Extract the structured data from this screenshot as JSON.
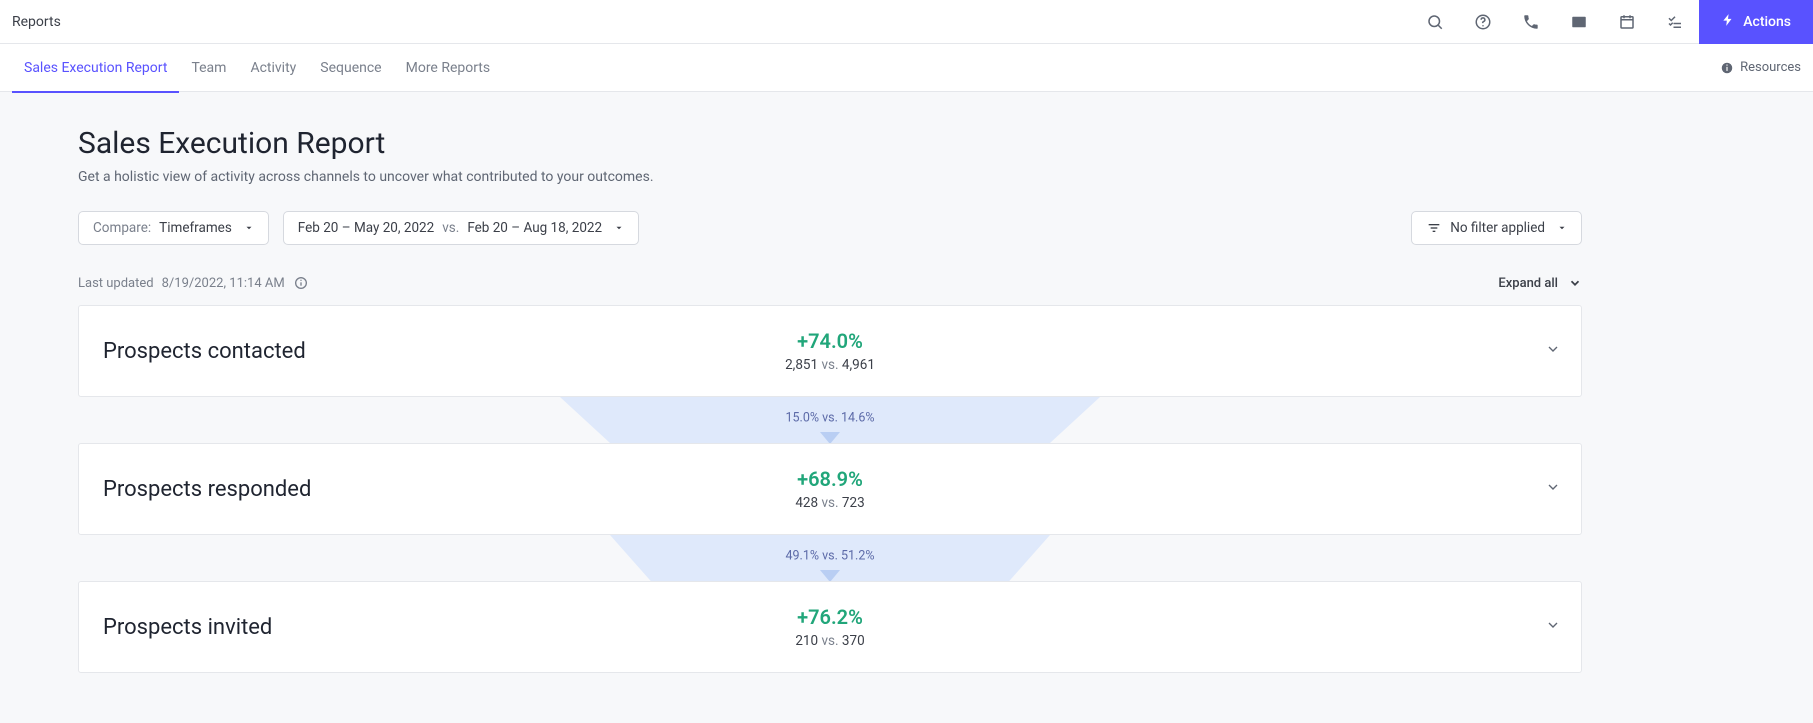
{
  "header": {
    "title": "Reports",
    "actions_label": "Actions"
  },
  "tabs": {
    "items": [
      {
        "label": "Sales Execution Report"
      },
      {
        "label": "Team"
      },
      {
        "label": "Activity"
      },
      {
        "label": "Sequence"
      },
      {
        "label": "More Reports"
      }
    ],
    "resources_label": "Resources"
  },
  "page": {
    "title": "Sales Execution Report",
    "subtitle": "Get a holistic view of activity across channels to uncover what contributed to your outcomes."
  },
  "filters": {
    "compare_prefix": "Compare:",
    "compare_value": "Timeframes",
    "range_a": "Feb 20 – May 20, 2022",
    "vs": "vs.",
    "range_b": "Feb 20 – Aug 18, 2022",
    "filter_label": "No filter applied"
  },
  "meta": {
    "last_updated_label": "Last updated",
    "last_updated_value": "8/19/2022, 11:14 AM",
    "expand_all": "Expand all"
  },
  "cards": [
    {
      "title": "Prospects contacted",
      "pct": "+74.0%",
      "a": "2,851",
      "vs": "vs.",
      "b": "4,961"
    },
    {
      "title": "Prospects responded",
      "pct": "+68.9%",
      "a": "428",
      "vs": "vs.",
      "b": "723"
    },
    {
      "title": "Prospects invited",
      "pct": "+76.2%",
      "a": "210",
      "vs": "vs.",
      "b": "370"
    }
  ],
  "funnels": [
    {
      "text": "15.0% vs. 14.6%"
    },
    {
      "text": "49.1% vs. 51.2%"
    }
  ]
}
